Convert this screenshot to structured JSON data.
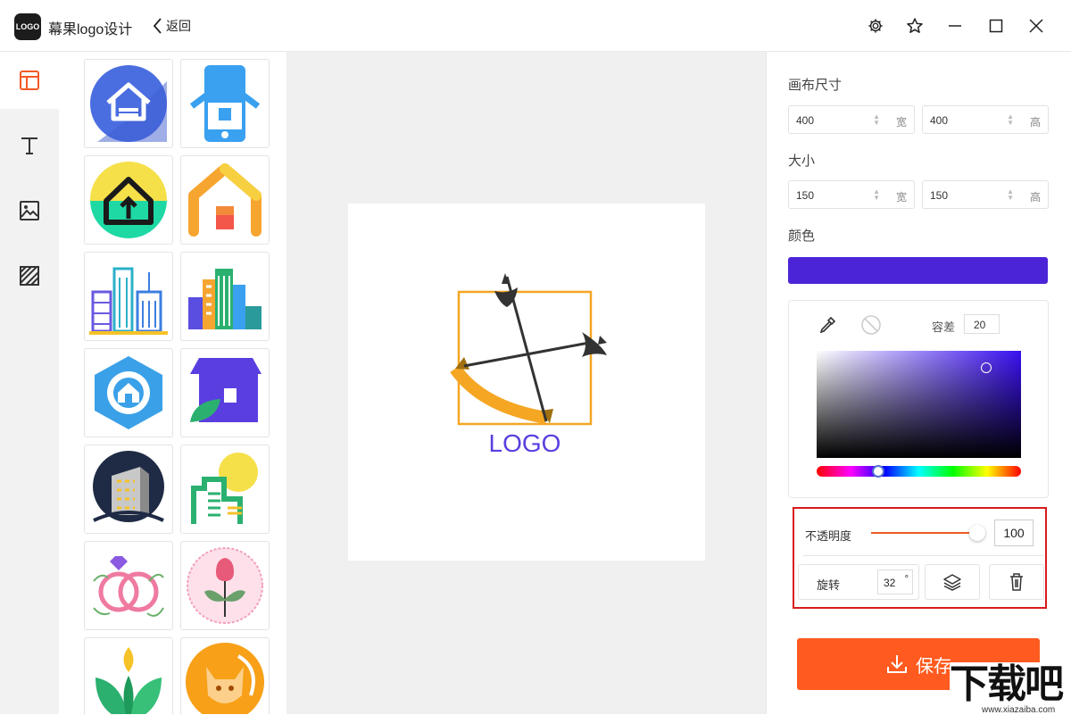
{
  "app": {
    "logo_text": "LOGO",
    "title": "幕果logo设计",
    "back_label": "返回"
  },
  "titlebar_icons": [
    "gear-icon",
    "star-icon",
    "minimize-icon",
    "maximize-icon",
    "close-icon"
  ],
  "sidebar": {
    "items": [
      {
        "name": "template",
        "icon": "layout-icon",
        "active": true
      },
      {
        "name": "text",
        "icon": "text-icon",
        "active": false
      },
      {
        "name": "image",
        "icon": "image-icon",
        "active": false
      },
      {
        "name": "background",
        "icon": "hatch-icon",
        "active": false
      }
    ]
  },
  "gallery": {
    "items": [
      "house-blue-circle",
      "house-phone",
      "house-arrow-yellow",
      "house-orange-roof",
      "city-buildings-blue",
      "city-buildings-color",
      "house-hexagon",
      "shop-leaf",
      "building-night",
      "building-sun",
      "rings-diamond",
      "rose-badge",
      "leaf-green",
      "fox-orange"
    ]
  },
  "canvas": {
    "logo_text": "LOGO",
    "logo_text_color": "#5a3ee0",
    "frame_color": "#f5a623",
    "axe_color": "#333333",
    "bow_color": "#f5a623"
  },
  "props": {
    "canvas_size": {
      "label": "画布尺寸",
      "width": "400",
      "width_unit": "宽",
      "height": "400",
      "height_unit": "高"
    },
    "size": {
      "label": "大小",
      "width": "150",
      "width_unit": "宽",
      "height": "150",
      "height_unit": "高"
    },
    "color": {
      "label": "颜色",
      "value": "#4c24d8"
    },
    "picker": {
      "tolerance_label": "容差",
      "tolerance": "20",
      "hue_position": 0.3
    },
    "opacity": {
      "label": "不透明度",
      "value": "100"
    },
    "rotate": {
      "label": "旋转",
      "value": "32",
      "unit": "°"
    },
    "save_label": "保存"
  },
  "watermark": {
    "text": "下载吧",
    "url": "www.xiazaiba.com"
  }
}
